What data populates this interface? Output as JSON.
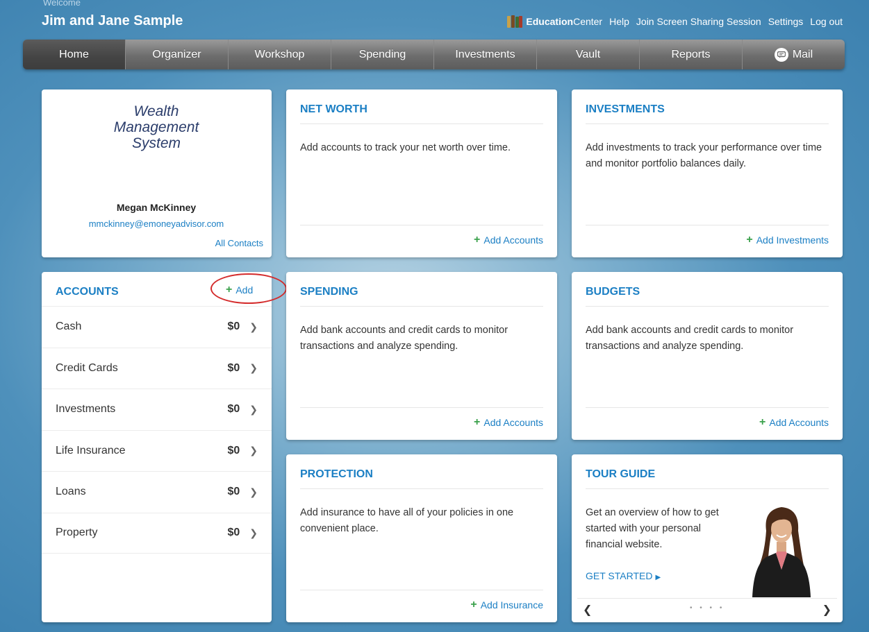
{
  "header": {
    "welcome_label": "Welcome",
    "user_name": "Jim and Jane Sample",
    "links": {
      "education_bold": "Education",
      "education_rest": " Center",
      "help": "Help",
      "screen_share": "Join Screen Sharing Session",
      "settings": "Settings",
      "logout": "Log out"
    }
  },
  "nav": {
    "tabs": [
      "Home",
      "Organizer",
      "Workshop",
      "Spending",
      "Investments",
      "Vault",
      "Reports",
      "Mail"
    ],
    "active": "Home"
  },
  "advisor": {
    "logo_line1": "Wealth",
    "logo_line2": "Management",
    "logo_line3": "System",
    "name": "Megan McKinney",
    "email": "mmckinney@emoneyadvisor.com",
    "contacts_link": "All Contacts"
  },
  "accounts": {
    "title": "ACCOUNTS",
    "add_label": "Add",
    "rows": [
      {
        "label": "Cash",
        "value": "$0"
      },
      {
        "label": "Credit Cards",
        "value": "$0"
      },
      {
        "label": "Investments",
        "value": "$0"
      },
      {
        "label": "Life Insurance",
        "value": "$0"
      },
      {
        "label": "Loans",
        "value": "$0"
      },
      {
        "label": "Property",
        "value": "$0"
      }
    ]
  },
  "cards": {
    "net_worth": {
      "title": "NET WORTH",
      "body": "Add accounts to track your net worth over time.",
      "action": "Add Accounts"
    },
    "investments": {
      "title": "INVESTMENTS",
      "body": "Add investments to track your performance over time and monitor portfolio balances daily.",
      "action": "Add Investments"
    },
    "spending": {
      "title": "SPENDING",
      "body": "Add bank accounts and credit cards to monitor transactions and analyze spending.",
      "action": "Add Accounts"
    },
    "budgets": {
      "title": "BUDGETS",
      "body": "Add bank accounts and credit cards to monitor transactions and analyze spending.",
      "action": "Add Accounts"
    },
    "protection": {
      "title": "PROTECTION",
      "body": "Add insurance to have all of your policies in one convenient place.",
      "action": "Add Insurance"
    },
    "tour_guide": {
      "title": "TOUR GUIDE",
      "body": "Get an overview of how to get started with your personal financial website.",
      "action": "GET STARTED",
      "dots": "• • • •"
    }
  },
  "icons": {
    "education": "books-icon",
    "mail": "mail-icon",
    "add": "plus-icon",
    "row_chevron": "chevron-right-icon",
    "tour_prev": "chevron-left-icon",
    "tour_next": "chevron-right-icon"
  },
  "colors": {
    "accent_blue": "#1b7fc4",
    "add_green": "#3aa14b",
    "highlight_red": "#d42b2b",
    "nav_gray": "#6d6d6d"
  }
}
